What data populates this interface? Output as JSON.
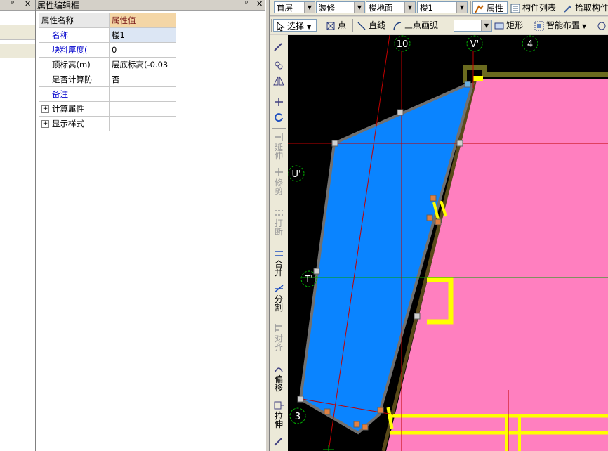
{
  "left_dock": {
    "pin": "ᵖ",
    "close": "✕"
  },
  "property_panel": {
    "title": "属性编辑框",
    "pin": "ᵖ",
    "close": "✕",
    "header": {
      "name": "属性名称",
      "value": "属性值"
    },
    "rows": [
      {
        "name": "名称",
        "value": "楼1"
      },
      {
        "name": "块料厚度(",
        "value": "0"
      },
      {
        "name": "顶标高(m)",
        "value": "层底标高(-0.03"
      },
      {
        "name": "是否计算防",
        "value": "否"
      },
      {
        "name": "备注",
        "value": ""
      },
      {
        "name": "计算属性",
        "value": "",
        "expander": "+"
      },
      {
        "name": "显示样式",
        "value": "",
        "expander": "+"
      }
    ]
  },
  "toolbar1": {
    "floor": "首层",
    "category": "装修",
    "component_type": "楼地面",
    "component": "楼1",
    "properties": "属性",
    "component_list": "构件列表",
    "pick_component": "拾取构件"
  },
  "toolbar2": {
    "select": "选择",
    "point": "点",
    "line": "直线",
    "arc3": "三点画弧",
    "arc_combo": "",
    "rect": "矩形",
    "smart_layout": "智能布置"
  },
  "vtools": {
    "extend": "延伸",
    "trim": "修剪",
    "break": "打断",
    "merge": "合并",
    "split": "分割",
    "align": "对齐",
    "offset": "偏移",
    "stretch": "拉伸"
  },
  "canvas": {
    "axes": {
      "a10": "10",
      "aV": "V'",
      "a4": "4",
      "aU": "U'",
      "aT": "T'",
      "a3": "3"
    },
    "colors": {
      "floor_fill": "#0a84ff",
      "room_fill": "#ff7fbf",
      "wall": "#ffff00",
      "outline": "#6b6b1f"
    }
  }
}
